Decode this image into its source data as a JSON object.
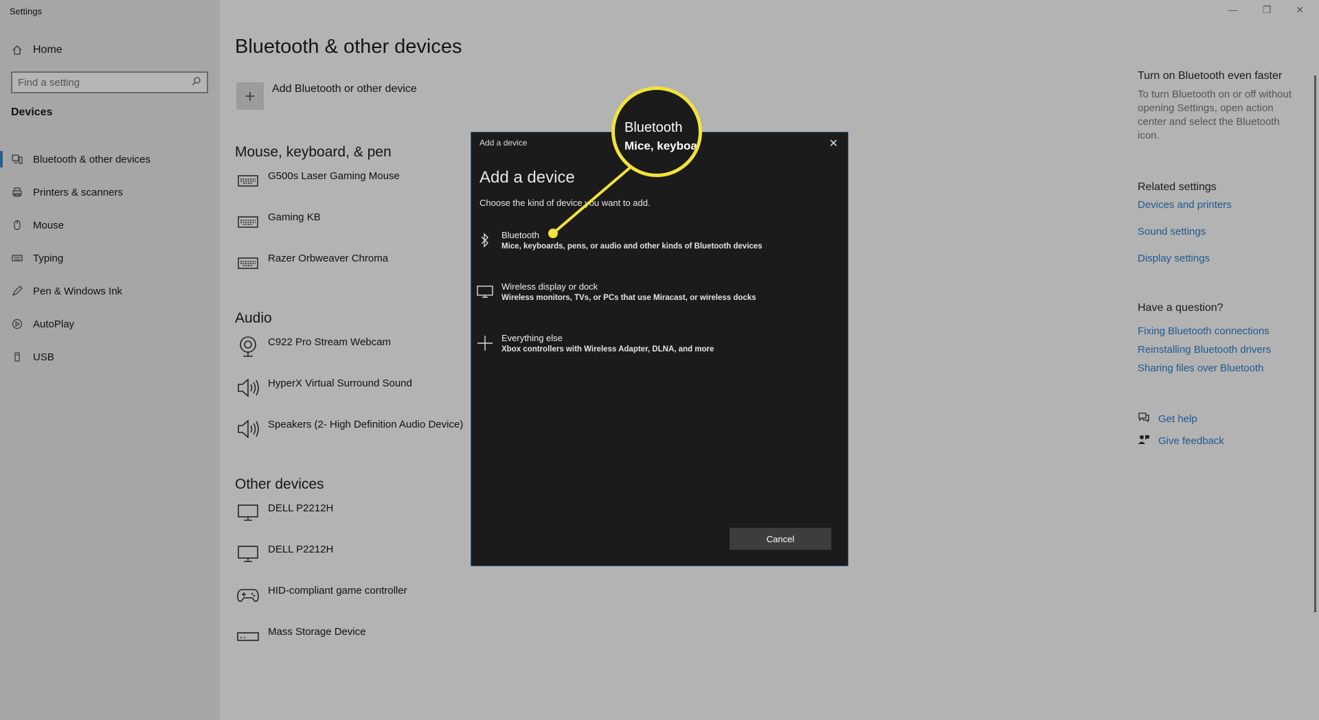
{
  "window": {
    "app_title": "Settings",
    "minimize": "—",
    "maximize": "❐",
    "close": "✕"
  },
  "sidebar": {
    "home": "Home",
    "search_placeholder": "Find a setting",
    "section": "Devices",
    "items": [
      {
        "label": "Bluetooth & other devices",
        "icon": "bluetooth-devices-icon",
        "active": true
      },
      {
        "label": "Printers & scanners",
        "icon": "printer-icon"
      },
      {
        "label": "Mouse",
        "icon": "mouse-icon"
      },
      {
        "label": "Typing",
        "icon": "keyboard-icon"
      },
      {
        "label": "Pen & Windows Ink",
        "icon": "pen-icon"
      },
      {
        "label": "AutoPlay",
        "icon": "autoplay-icon"
      },
      {
        "label": "USB",
        "icon": "usb-icon"
      }
    ]
  },
  "main": {
    "title": "Bluetooth & other devices",
    "add_label": "Add Bluetooth or other device",
    "groups": [
      {
        "title": "Mouse, keyboard, & pen",
        "devices": [
          "G500s Laser Gaming Mouse",
          "Gaming KB",
          "Razer Orbweaver Chroma"
        ]
      },
      {
        "title": "Audio",
        "devices": [
          "C922 Pro Stream Webcam",
          "HyperX Virtual Surround Sound",
          "Speakers (2- High Definition Audio Device)"
        ]
      },
      {
        "title": "Other devices",
        "devices": [
          "DELL P2212H",
          "DELL P2212H",
          "HID-compliant game controller",
          "Mass Storage Device"
        ]
      }
    ]
  },
  "right_pane": {
    "tip_title": "Turn on Bluetooth even faster",
    "tip_text": "To turn Bluetooth on or off without opening Settings, open action center and select the Bluetooth icon.",
    "related_title": "Related settings",
    "related_links": [
      "Devices and printers",
      "Sound settings",
      "Display settings"
    ],
    "question_title": "Have a question?",
    "question_links": [
      "Fixing Bluetooth connections",
      "Reinstalling Bluetooth drivers",
      "Sharing files over Bluetooth"
    ],
    "get_help": "Get help",
    "give_feedback": "Give feedback"
  },
  "dialog": {
    "title": "Add a device",
    "close": "✕",
    "heading": "Add a device",
    "subtitle": "Choose the kind of device you want to add.",
    "options": [
      {
        "title": "Bluetooth",
        "desc": "Mice, keyboards, pens, or audio and other kinds of Bluetooth devices",
        "icon": "bluetooth-icon"
      },
      {
        "title": "Wireless display or dock",
        "desc": "Wireless monitors, TVs, or PCs that use Miracast, or wireless docks",
        "icon": "monitor-icon"
      },
      {
        "title": "Everything else",
        "desc": "Xbox controllers with Wireless Adapter, DLNA, and more",
        "icon": "plus-icon"
      }
    ],
    "cancel": "Cancel"
  },
  "callout": {
    "line1": "Bluetooth",
    "line2": "Mice, keyboa",
    "color": "#f3e33b"
  }
}
